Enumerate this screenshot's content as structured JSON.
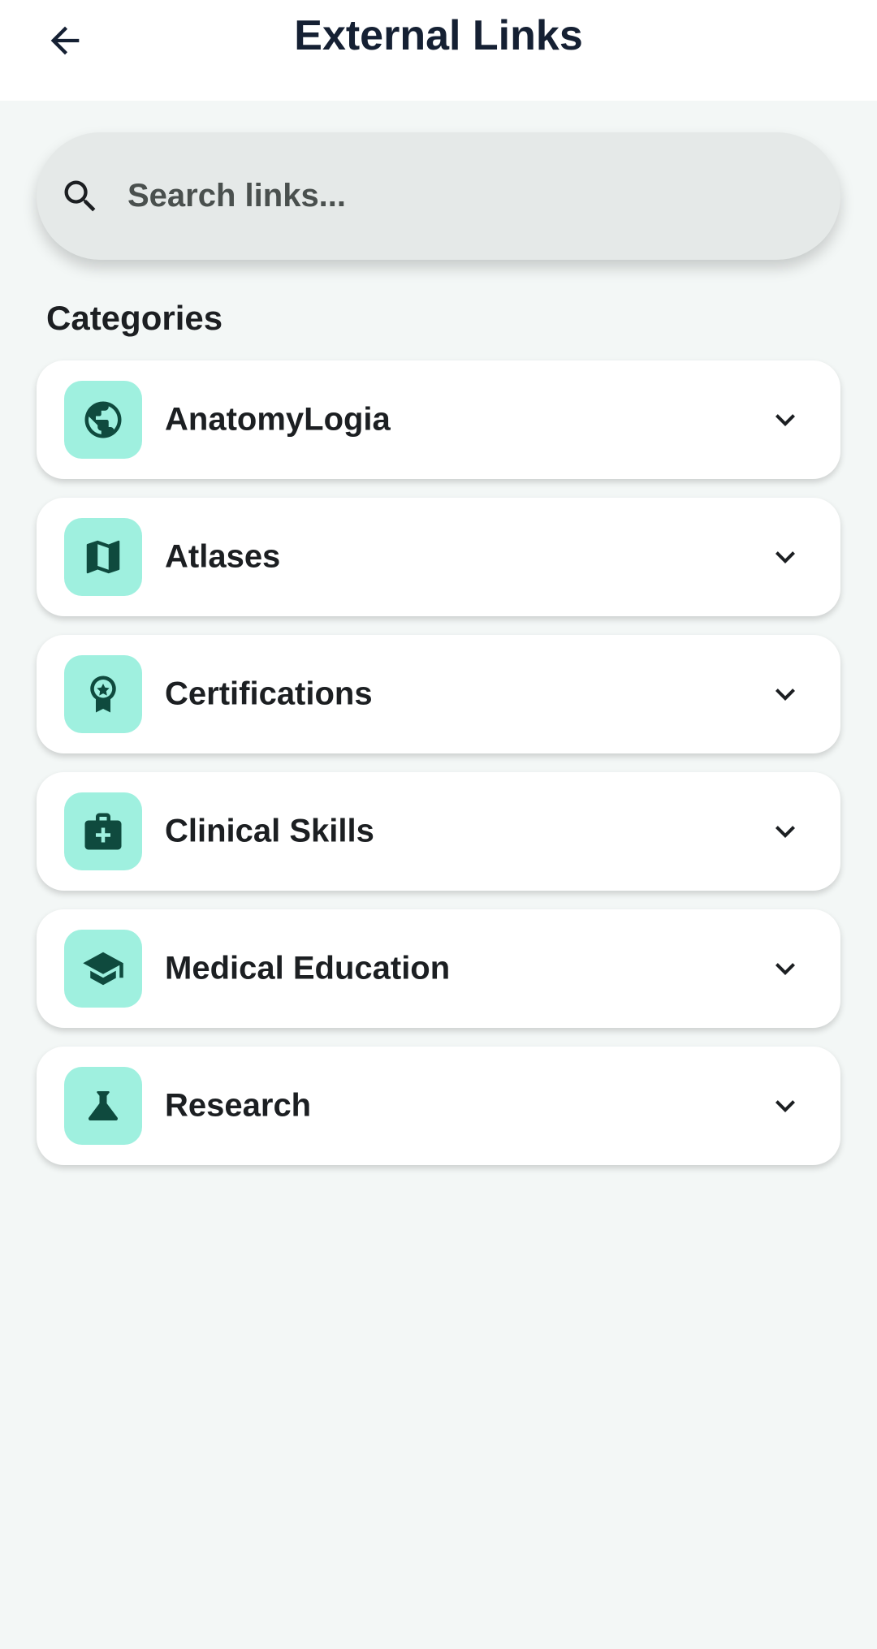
{
  "header": {
    "title": "External Links"
  },
  "search": {
    "placeholder": "Search links..."
  },
  "section": {
    "heading": "Categories"
  },
  "categories": [
    {
      "label": "AnatomyLogia",
      "icon": "globe-icon"
    },
    {
      "label": "Atlases",
      "icon": "map-icon"
    },
    {
      "label": "Certifications",
      "icon": "award-icon"
    },
    {
      "label": "Clinical Skills",
      "icon": "medical-bag-icon"
    },
    {
      "label": "Medical Education",
      "icon": "graduation-cap-icon"
    },
    {
      "label": "Research",
      "icon": "flask-icon"
    }
  ],
  "colors": {
    "accent_bg": "#9ff0df",
    "accent_icon": "#0f4a3e",
    "page_bg": "#f3f7f6",
    "title": "#152033"
  }
}
